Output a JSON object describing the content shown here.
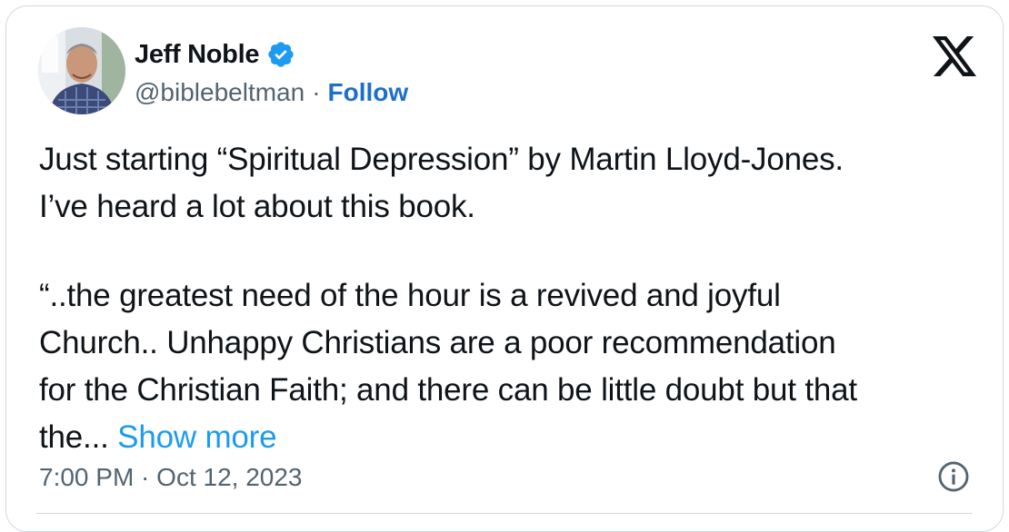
{
  "author": {
    "name": "Jeff Noble",
    "handle": "@biblebeltman",
    "separator": "·",
    "follow_label": "Follow",
    "verified_icon": "verified-badge-icon",
    "avatar_icon": "profile-photo"
  },
  "platform_icon": "x-logo-icon",
  "tweet": {
    "lines": [
      "Just starting “Spiritual Depression” by Martin Lloyd-Jones.",
      "I’ve heard a lot about this book.",
      "“..the greatest need of the hour is a revived and joyful",
      "Church.. Unhappy Christians are a poor recommendation",
      "for the Christian Faith; and there can be little doubt but that",
      "the..."
    ],
    "show_more_label": "Show more"
  },
  "timestamp": "7:00 PM · Oct 12, 2023",
  "info_icon": "info-icon",
  "colors": {
    "text": "#0f1419",
    "secondary": "#536471",
    "link": "#1d9bf0",
    "follow": "#1d70c9",
    "border": "#cfd9de"
  }
}
